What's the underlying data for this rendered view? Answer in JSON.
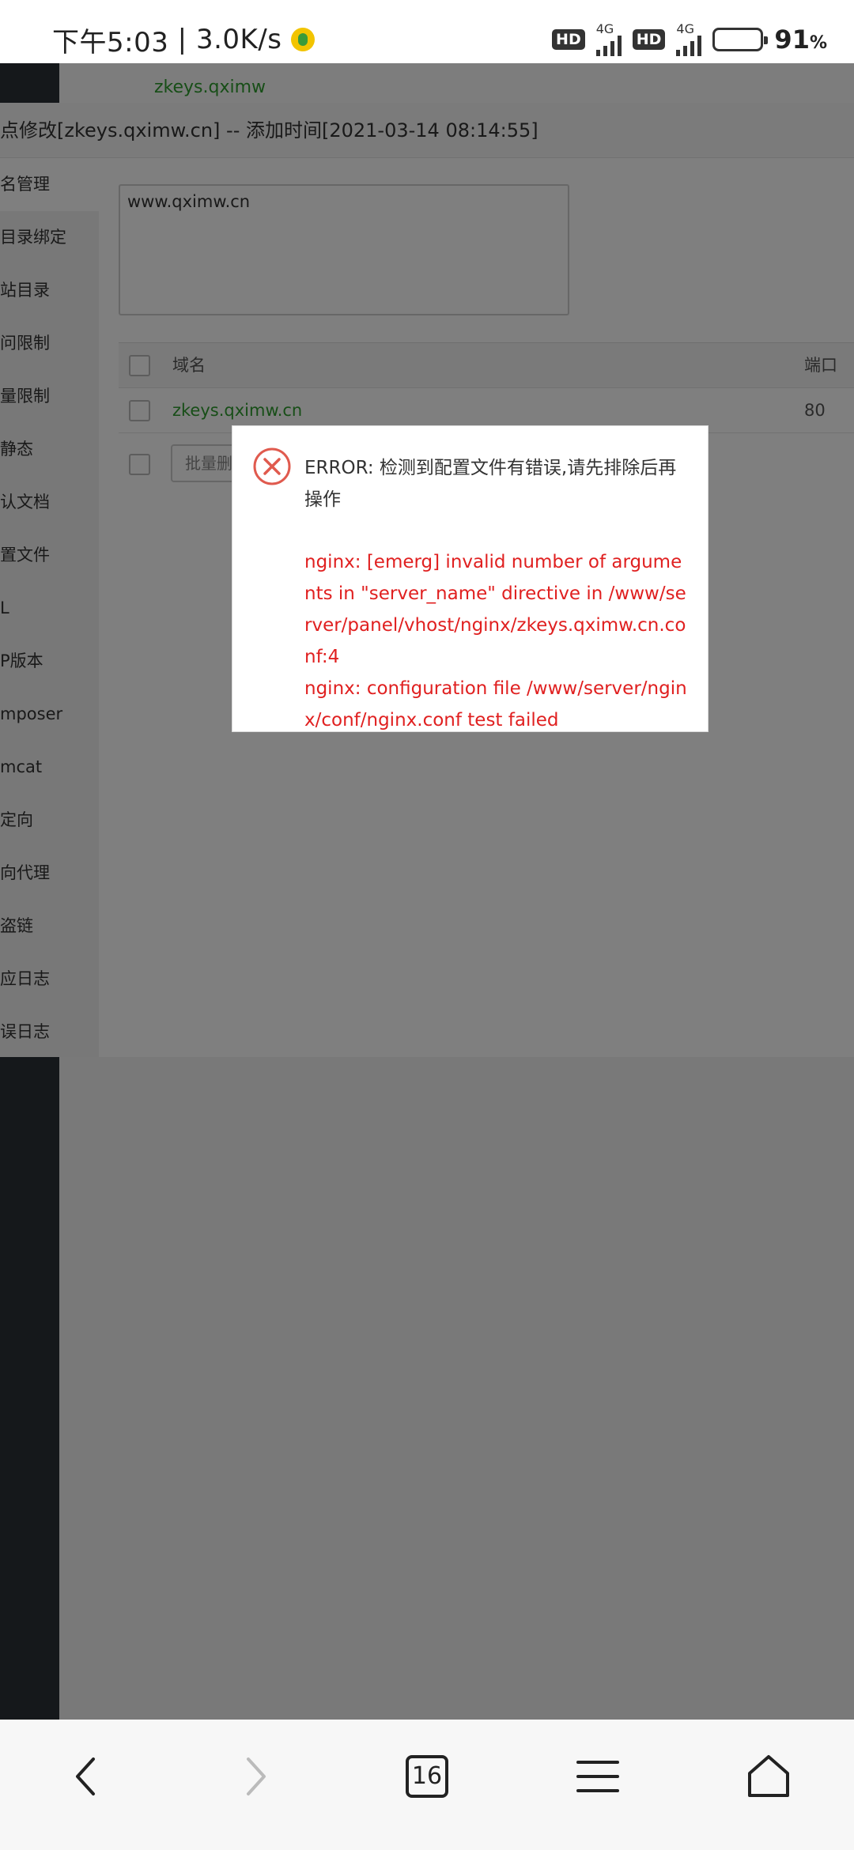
{
  "status_bar": {
    "time": "下午5:03",
    "net_speed": "3.0K/s",
    "hd1": "HD",
    "gen1": "4G",
    "hd2": "HD",
    "gen2": "4G",
    "battery_value": "91",
    "battery_unit": "%"
  },
  "background": {
    "row_partial_text": "zkeys.qximw"
  },
  "panel": {
    "title": "点修改[zkeys.qximw.cn] -- 添加时间[2021-03-14 08:14:55]",
    "menu": [
      "名管理",
      "目录绑定",
      "站目录",
      "问限制",
      "量限制",
      "静态",
      "认文档",
      "置文件",
      "L",
      "P版本",
      "mposer",
      "mcat",
      "定向",
      "向代理",
      "盗链",
      "应日志",
      "误日志"
    ],
    "domain_textarea": "www.qximw.cn",
    "table": {
      "col_name": "域名",
      "col_port": "端口",
      "rows": [
        {
          "name": "zkeys.qximw.cn",
          "port": "80"
        }
      ]
    },
    "batch_delete": "批量删除"
  },
  "dialog": {
    "title": "ERROR: 检测到配置文件有错误,请先排除后再操作",
    "detail_line1": "nginx: [emerg] invalid number of arguments in \"server_name\" directive in /www/server/panel/vhost/nginx/zkeys.qximw.cn.conf:4",
    "detail_line2": "nginx: configuration file /www/server/nginx/conf/nginx.conf test failed",
    "accent_color": "#e02020"
  },
  "bottom_nav": {
    "tab_count": "16"
  }
}
